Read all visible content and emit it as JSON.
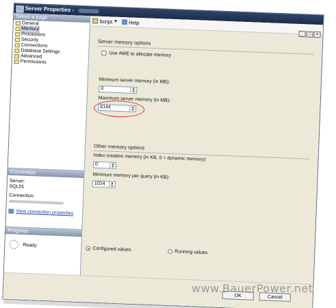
{
  "window": {
    "title": "Server Properties -"
  },
  "left_panel": {
    "select_page_header": "Select a page",
    "pages": [
      {
        "label": "General",
        "selected": false
      },
      {
        "label": "Memory",
        "selected": true
      },
      {
        "label": "Processors",
        "selected": false
      },
      {
        "label": "Security",
        "selected": false
      },
      {
        "label": "Connections",
        "selected": false
      },
      {
        "label": "Database Settings",
        "selected": false
      },
      {
        "label": "Advanced",
        "selected": false
      },
      {
        "label": "Permissions",
        "selected": false
      }
    ],
    "connection_header": "Connection",
    "server_label": "Server:",
    "server_value": "SQL01",
    "connection_label": "Connection:",
    "view_connection_link": "View connection properties",
    "progress_header": "Progress",
    "progress_status": "Ready"
  },
  "toolbar": {
    "script_label": "Script",
    "help_label": "Help"
  },
  "server_memory": {
    "group_label": "Server memory options",
    "awe_label": "Use AWE to allocate memory",
    "awe_checked": false,
    "min_label": "Minimum server memory (in MB):",
    "min_value": "0",
    "max_label": "Maximum server memory (in MB):",
    "max_value": "6144"
  },
  "other_memory": {
    "group_label": "Other memory options",
    "index_label": "Index creation memory (in KB, 0 = dynamic memory):",
    "index_value": "0",
    "min_query_label": "Minimum memory per query (in KB):",
    "min_query_value": "1024"
  },
  "values_mode": {
    "configured_label": "Configured values",
    "running_label": "Running values",
    "selected": "configured"
  },
  "buttons": {
    "ok_label": "OK",
    "cancel_label": "Cancel"
  },
  "watermark": "www.BauerPower.net",
  "colors": {
    "title_bar": "#1d2c4a",
    "highlight_circle": "#e03535",
    "link": "#1a3ea8"
  }
}
